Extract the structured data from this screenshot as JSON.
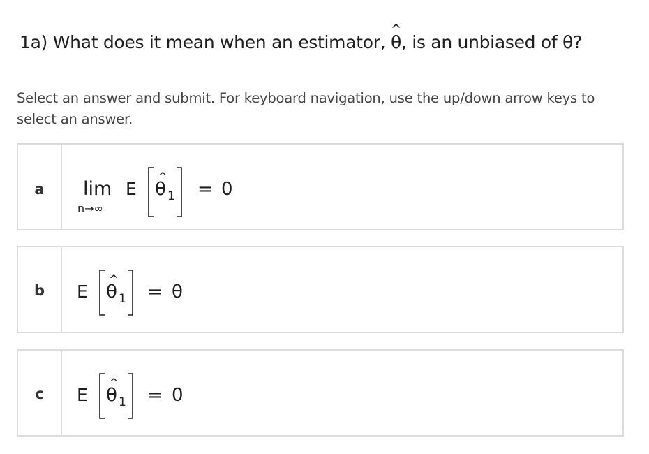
{
  "question": {
    "prefix": "1a) What does it mean when an estimator, ",
    "estimator_symbol": "θ",
    "middle": ", is an unbiased of ",
    "parameter_symbol": "θ",
    "suffix": "?"
  },
  "instructions": "Select an answer and submit. For keyboard navigation, use the up/down arrow keys to select an answer.",
  "options": [
    {
      "letter": "a",
      "lim": "lim",
      "lim_sub": "n→∞",
      "expect": "E",
      "theta": "θ",
      "sub": "1",
      "equals": "=",
      "rhs": "0"
    },
    {
      "letter": "b",
      "expect": "E",
      "theta": "θ",
      "sub": "1",
      "equals": "=",
      "rhs": "θ"
    },
    {
      "letter": "c",
      "expect": "E",
      "theta": "θ",
      "sub": "1",
      "equals": "=",
      "rhs": "0"
    }
  ],
  "colors": {
    "border": "#dcdcdc",
    "text": "#1e1e1e",
    "instructions": "#444444"
  }
}
